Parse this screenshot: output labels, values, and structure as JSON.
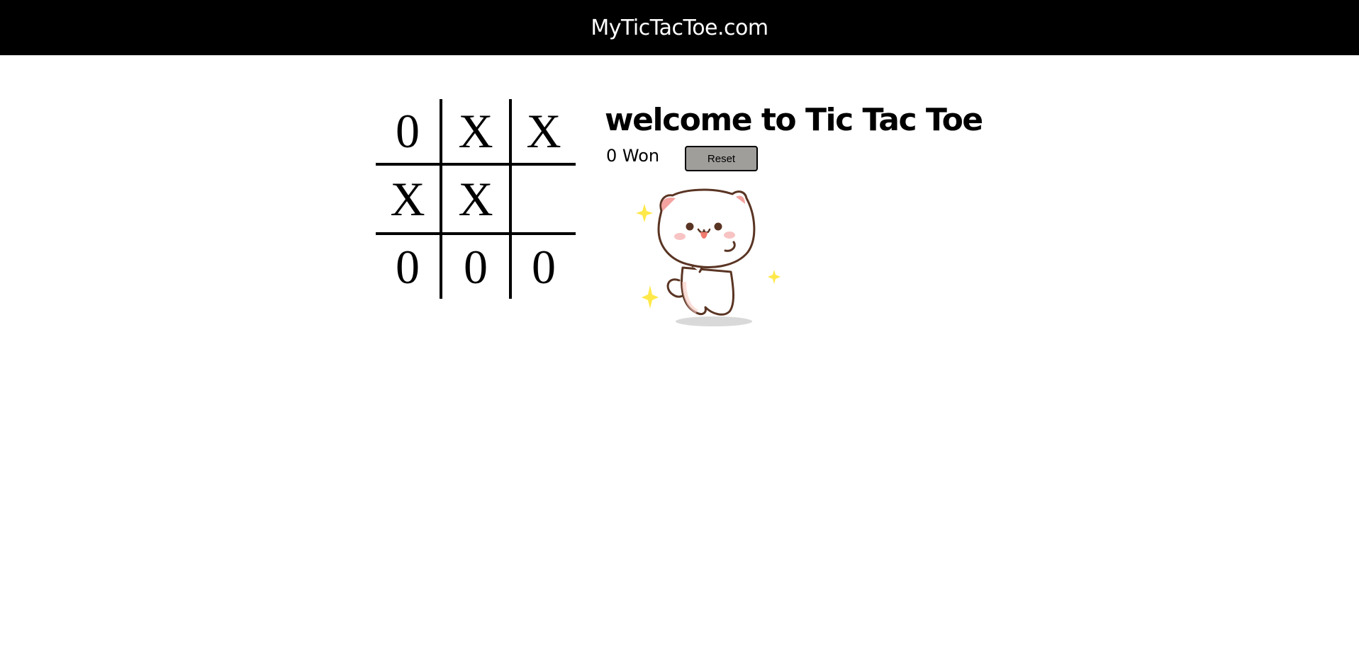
{
  "header": {
    "title": "MyTicTacToe.com"
  },
  "board": {
    "cells": [
      "0",
      "X",
      "X",
      "X",
      "X",
      "",
      "0",
      "0",
      "0"
    ]
  },
  "info": {
    "welcome": "welcome to Tic Tac Toe",
    "status": "0 Won",
    "reset_label": "Reset"
  },
  "mascot": {
    "icon": "dancing-cat-icon"
  },
  "colors": {
    "navbar": "#000000",
    "reset_button": "#a09e9b",
    "sparkle": "#ffe94a"
  }
}
